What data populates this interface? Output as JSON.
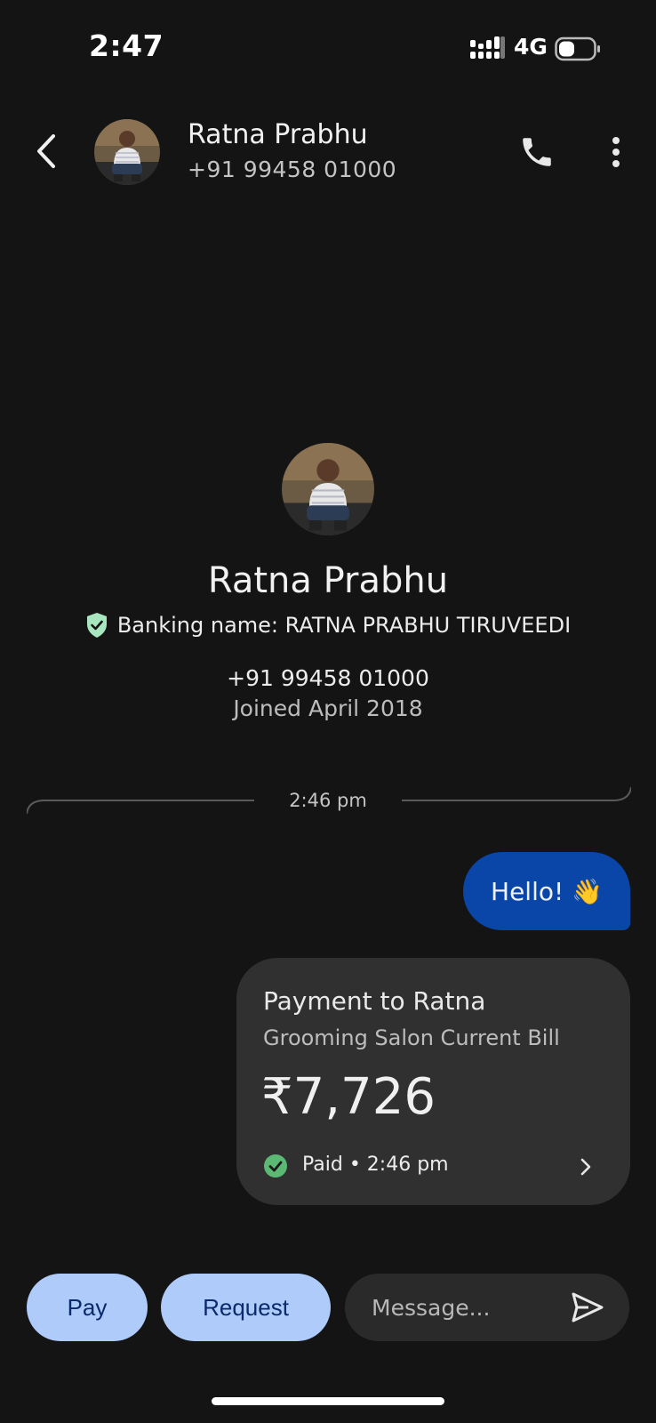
{
  "status_bar": {
    "time": "2:47",
    "network": "4G"
  },
  "header": {
    "contact_name": "Ratna Prabhu",
    "contact_phone": "+91 99458 01000"
  },
  "profile": {
    "name": "Ratna Prabhu",
    "banking_name": "Banking name: RATNA PRABHU TIRUVEEDI",
    "phone": "+91 99458 01000",
    "joined": "Joined April 2018"
  },
  "conversation": {
    "divider_time": "2:46 pm",
    "messages": [
      {
        "text": "Hello! 👋"
      }
    ],
    "payment": {
      "title": "Payment to Ratna",
      "note": "Grooming Salon Current Bill",
      "amount": "₹7,726",
      "status": "Paid • 2:46 pm"
    }
  },
  "bottom_bar": {
    "pay_label": "Pay",
    "request_label": "Request",
    "message_placeholder": "Message..."
  },
  "colors": {
    "background": "#141414",
    "sent_bubble": "#0a46a8",
    "card": "#303030",
    "action_button": "#aecbfa",
    "success": "#5bb974"
  },
  "icons": [
    "signal-icon",
    "battery-icon",
    "back-icon",
    "call-icon",
    "more-icon",
    "shield-check-icon",
    "check-circle-icon",
    "chevron-right-icon",
    "send-icon"
  ]
}
